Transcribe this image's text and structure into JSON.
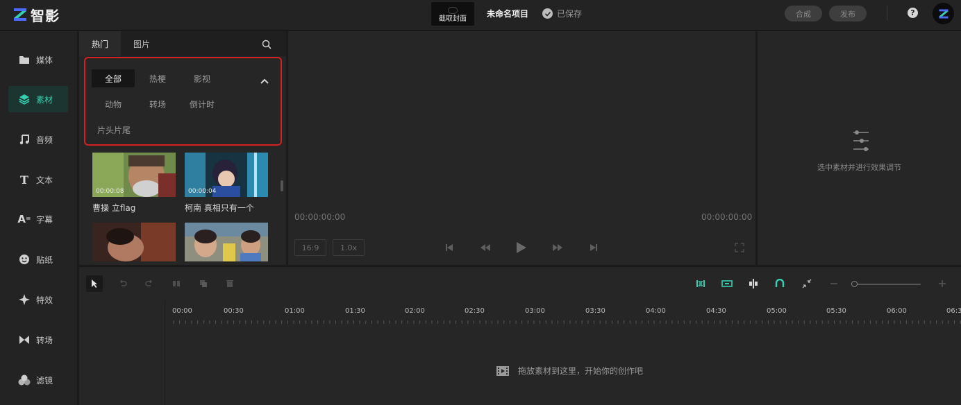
{
  "app": {
    "name": "智影"
  },
  "topbar": {
    "cover_label": "截取封面",
    "project_name": "未命名项目",
    "save_status": "已保存",
    "compose_label": "合成",
    "publish_label": "发布",
    "help_glyph": "?"
  },
  "sidebar": {
    "items": [
      {
        "label": "媒体",
        "icon": "folder-icon"
      },
      {
        "label": "素材",
        "icon": "layers-icon"
      },
      {
        "label": "音频",
        "icon": "music-note-icon"
      },
      {
        "label": "文本",
        "icon": "text-icon"
      },
      {
        "label": "字幕",
        "icon": "subtitle-icon"
      },
      {
        "label": "贴纸",
        "icon": "sticker-icon"
      },
      {
        "label": "特效",
        "icon": "sparkle-icon"
      },
      {
        "label": "转场",
        "icon": "transition-icon"
      },
      {
        "label": "滤镜",
        "icon": "filter-icon"
      }
    ],
    "active_index": 1
  },
  "materials": {
    "tabs": [
      {
        "label": "热门"
      },
      {
        "label": "图片"
      }
    ],
    "categories": [
      {
        "label": "全部"
      },
      {
        "label": "热梗"
      },
      {
        "label": "影视"
      },
      {
        "label": "动物"
      },
      {
        "label": "转场"
      },
      {
        "label": "倒计时"
      },
      {
        "label": "片头片尾"
      }
    ],
    "items": [
      {
        "title": "曹操 立flag",
        "duration": "00:00:08"
      },
      {
        "title": "柯南 真相只有一个",
        "duration": "00:00:04"
      },
      {
        "title": "",
        "duration": ""
      },
      {
        "title": "",
        "duration": ""
      }
    ]
  },
  "preview": {
    "time_current": "00:00:00:00",
    "time_total": "00:00:00:00",
    "aspect_ratio": "16:9",
    "speed": "1.0x"
  },
  "properties": {
    "empty_hint": "选中素材并进行效果调节"
  },
  "timeline": {
    "ticks": [
      "00:00",
      "00:30",
      "01:00",
      "01:30",
      "02:00",
      "02:30",
      "03:00",
      "03:30",
      "04:00",
      "04:30",
      "05:00",
      "05:30",
      "06:00",
      "06:3"
    ],
    "drop_hint": "拖放素材到这里，开始你的创作吧",
    "accent_color": "#33d1b2"
  }
}
